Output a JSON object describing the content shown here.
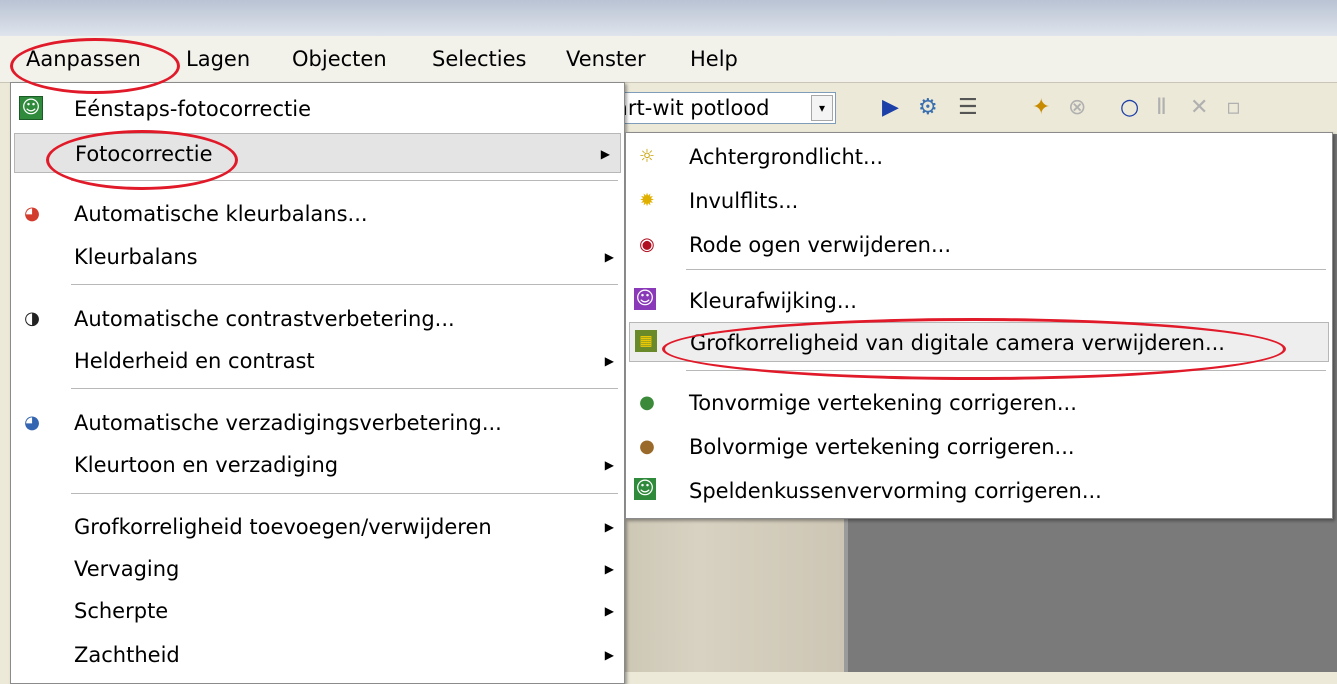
{
  "menubar": {
    "items": [
      "Aanpassen",
      "Lagen",
      "Objecten",
      "Selecties",
      "Venster",
      "Help"
    ]
  },
  "toolbar": {
    "combo_value": "art-wit potlood"
  },
  "menu_aanpassen": {
    "items": [
      {
        "label": "Eénstaps-fotocorrectie",
        "icon": "photo-person-icon"
      },
      {
        "label": "Fotocorrectie",
        "submenu": true
      },
      {
        "label": "Automatische kleurbalans...",
        "icon": "color-balance-icon"
      },
      {
        "label": "Kleurbalans",
        "submenu": true
      },
      {
        "label": "Automatische contrastverbetering...",
        "icon": "contrast-icon"
      },
      {
        "label": "Helderheid en contrast",
        "submenu": true
      },
      {
        "label": "Automatische verzadigingsverbetering...",
        "icon": "saturation-icon"
      },
      {
        "label": "Kleurtoon en verzadiging",
        "submenu": true
      },
      {
        "label": "Grofkorreligheid toevoegen/verwijderen",
        "submenu": true
      },
      {
        "label": "Vervaging",
        "submenu": true
      },
      {
        "label": "Scherpte",
        "submenu": true
      },
      {
        "label": "Zachtheid",
        "submenu": true
      }
    ]
  },
  "menu_fotocorrectie": {
    "items": [
      {
        "label": "Achtergrondlicht...",
        "icon": "backlight-icon"
      },
      {
        "label": "Invulflits...",
        "icon": "fill-flash-icon"
      },
      {
        "label": "Rode ogen verwijderen...",
        "icon": "red-eye-icon"
      },
      {
        "label": "Kleurafwijking...",
        "icon": "chromatic-aberration-icon"
      },
      {
        "label": "Grofkorreligheid van digitale camera verwijderen...",
        "icon": "camera-noise-icon"
      },
      {
        "label": "Tonvormige vertekening corrigeren...",
        "icon": "barrel-distortion-icon"
      },
      {
        "label": "Bolvormige vertekening corrigeren...",
        "icon": "fisheye-distortion-icon"
      },
      {
        "label": "Speldenkussenvervorming corrigeren...",
        "icon": "pincushion-icon"
      }
    ]
  }
}
